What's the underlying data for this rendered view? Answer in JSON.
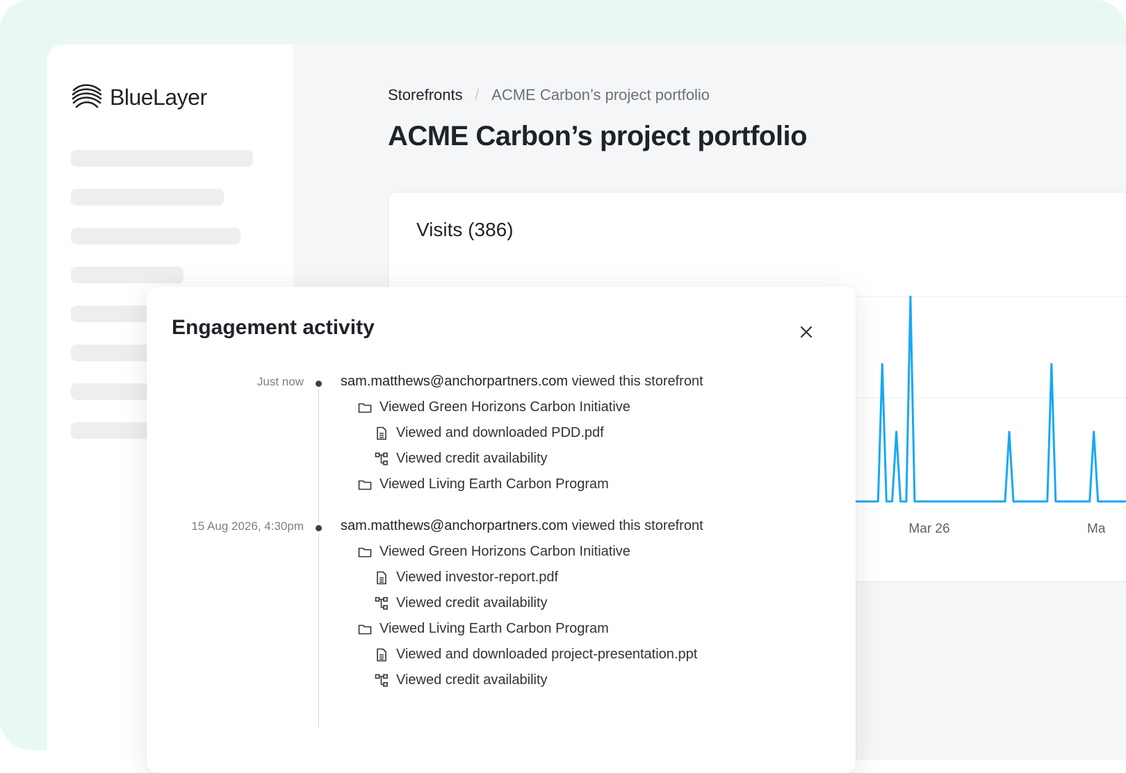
{
  "brand": {
    "name": "BlueLayer"
  },
  "breadcrumb": {
    "root": "Storefronts",
    "separator": "/",
    "current": "ACME Carbon’s project portfolio"
  },
  "page": {
    "title": "ACME Carbon’s project portfolio"
  },
  "visits": {
    "title": "Visits (386)",
    "line_color": "#19a7f5"
  },
  "chart_data": {
    "type": "line",
    "title": "Visits (386)",
    "x_tick_labels": [
      "Mar 26",
      "Ma"
    ],
    "series": [
      {
        "values_relative": [
          0,
          0,
          0.34,
          0,
          0,
          1.0,
          0,
          0,
          0.67,
          0.34,
          1.0,
          0,
          0,
          0,
          0,
          0,
          0,
          0.34,
          0,
          0,
          0.67,
          0,
          0,
          0.34,
          0
        ],
        "color": "#19a7f5"
      }
    ],
    "grid": true
  },
  "modal": {
    "title": "Engagement activity",
    "close_label": "×",
    "events": [
      {
        "time": "Just now",
        "user": "sam.matthews@anchorpartners.com",
        "action": " viewed this storefront",
        "items": [
          {
            "icon": "folder-icon",
            "text": "Viewed Green Horizons Carbon Initiative",
            "level": 1
          },
          {
            "icon": "document-icon",
            "text": "Viewed and downloaded PDD.pdf",
            "level": 2
          },
          {
            "icon": "hierarchy-icon",
            "text": "Viewed credit availability",
            "level": 2
          },
          {
            "icon": "folder-icon",
            "text": "Viewed Living Earth Carbon Program",
            "level": 1
          }
        ]
      },
      {
        "time": "15 Aug 2026, 4:30pm",
        "user": "sam.matthews@anchorpartners.com",
        "action": " viewed this storefront",
        "items": [
          {
            "icon": "folder-icon",
            "text": "Viewed Green Horizons Carbon Initiative",
            "level": 1
          },
          {
            "icon": "document-icon",
            "text": "Viewed investor-report.pdf",
            "level": 2
          },
          {
            "icon": "hierarchy-icon",
            "text": "Viewed credit availability",
            "level": 2
          },
          {
            "icon": "folder-icon",
            "text": "Viewed Living Earth Carbon Program",
            "level": 1
          },
          {
            "icon": "document-icon",
            "text": "Viewed and downloaded project-presentation.ppt",
            "level": 2
          },
          {
            "icon": "hierarchy-icon",
            "text": "Viewed credit availability",
            "level": 2
          }
        ]
      }
    ]
  }
}
